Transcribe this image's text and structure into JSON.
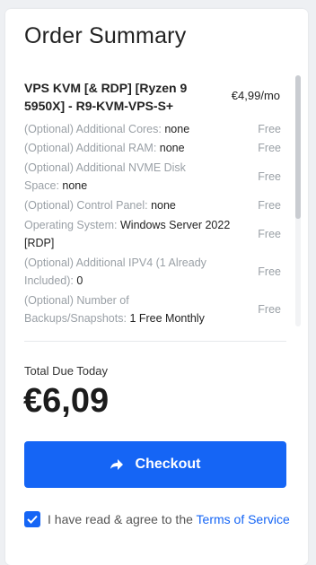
{
  "summary": {
    "title": "Order Summary",
    "product": {
      "name": "VPS KVM [& RDP] [Ryzen 9 5950X] - R9-KVM-VPS-S+",
      "price": "€4,99/mo"
    },
    "options": [
      {
        "label": "(Optional) Additional Cores:",
        "value": "none",
        "price": "Free"
      },
      {
        "label": "(Optional) Additional RAM:",
        "value": "none",
        "price": "Free"
      },
      {
        "label": "(Optional) Additional NVME Disk Space:",
        "value": "none",
        "price": "Free"
      },
      {
        "label": "(Optional) Control Panel:",
        "value": "none",
        "price": "Free"
      },
      {
        "label": "Operating System:",
        "value": "Windows Server 2022 [RDP]",
        "price": "Free"
      },
      {
        "label": "(Optional) Additional IPV4 (1 Already Included):",
        "value": "0",
        "price": "Free"
      },
      {
        "label": "(Optional) Number of Backups/Snapshots:",
        "value": "1 Free Monthly",
        "price": "Free"
      }
    ]
  },
  "total": {
    "label": "Total Due Today",
    "amount": "€6,09"
  },
  "checkout": {
    "label": "Checkout",
    "icon": "arrow-right-icon"
  },
  "agreement": {
    "text": "I have read & agree to the",
    "link": "Terms of Service",
    "checked": true
  },
  "colors": {
    "accent": "#1565f5",
    "muted": "#9aa0a6"
  }
}
